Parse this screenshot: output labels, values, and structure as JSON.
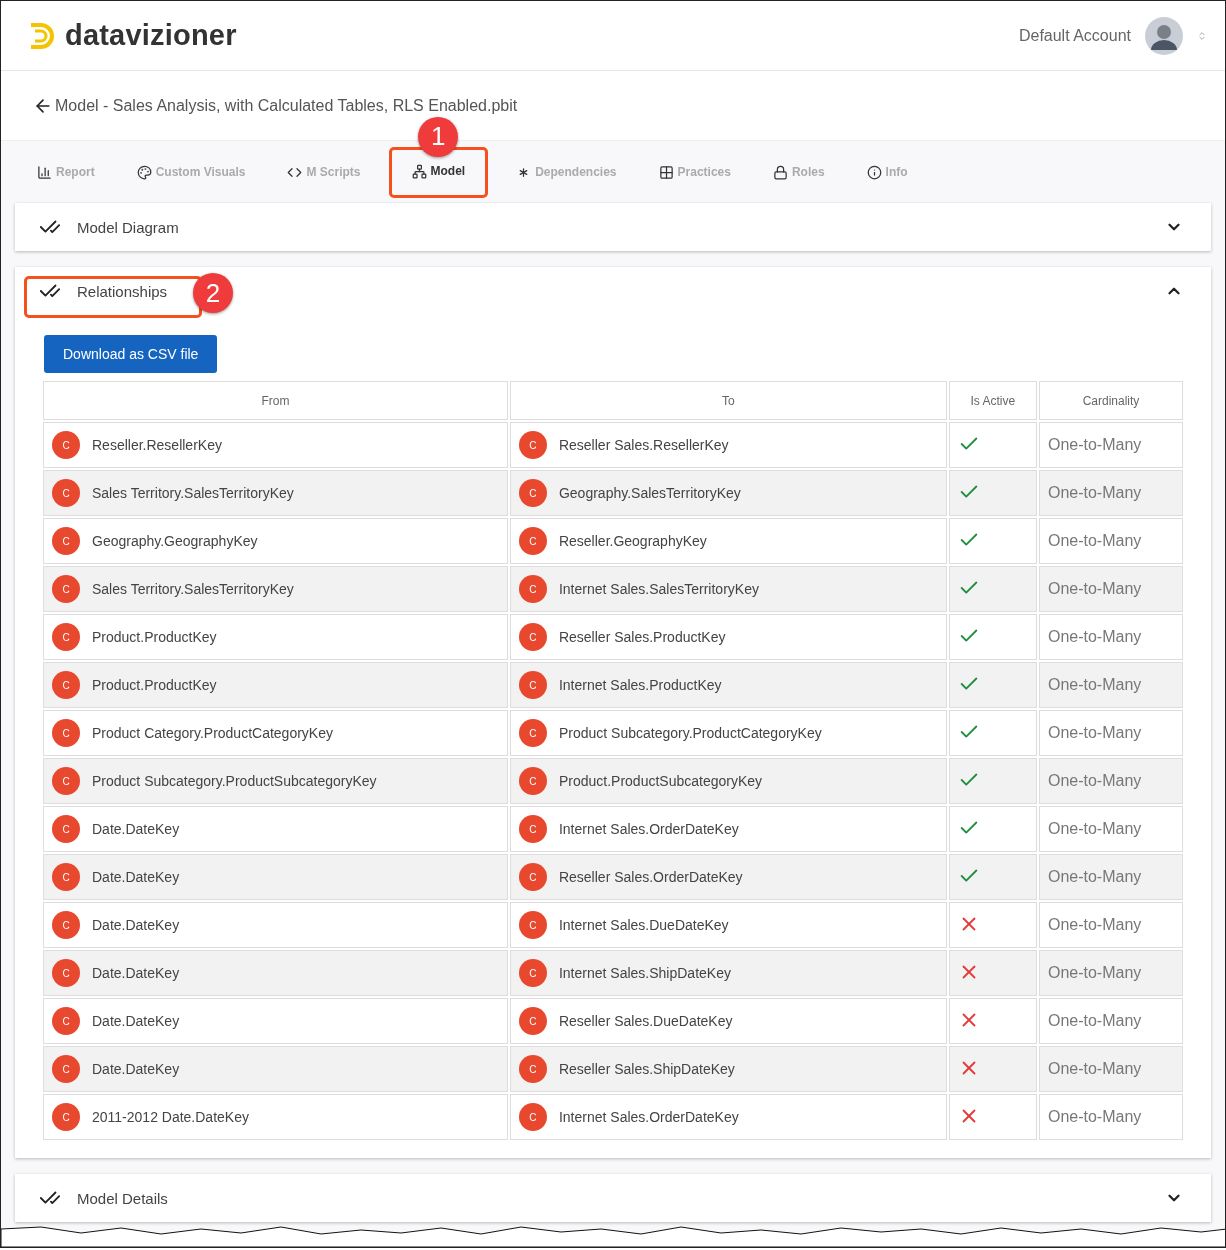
{
  "header": {
    "brand": "datavizioner",
    "account": "Default Account"
  },
  "breadcrumb": {
    "title": "Model - Sales Analysis, with Calculated Tables, RLS Enabled.pbit"
  },
  "tabs": [
    {
      "kind": "report",
      "label": "Report",
      "selected": false
    },
    {
      "kind": "visuals",
      "label": "Custom Visuals",
      "selected": false
    },
    {
      "kind": "scripts",
      "label": "M Scripts",
      "selected": false
    },
    {
      "kind": "model",
      "label": "Model",
      "selected": true,
      "callout": "1"
    },
    {
      "kind": "dependencies",
      "label": "Dependencies",
      "selected": false
    },
    {
      "kind": "practices",
      "label": "Practices",
      "selected": false
    },
    {
      "kind": "roles",
      "label": "Roles",
      "selected": false
    },
    {
      "kind": "info",
      "label": "Info",
      "selected": false
    }
  ],
  "panels": [
    {
      "title": "Model Diagram",
      "expanded": false
    },
    {
      "title": "Relationships",
      "expanded": true,
      "callout": "2",
      "download_button": "Download as CSV file",
      "table": {
        "columns": [
          "From",
          "To",
          "Is Active",
          "Cardinality"
        ],
        "rows": [
          {
            "from": {
              "badge": "C",
              "name": "Reseller.ResellerKey"
            },
            "to": {
              "badge": "C",
              "name": "Reseller Sales.ResellerKey"
            },
            "active": true,
            "cardinality": "One-to-Many"
          },
          {
            "from": {
              "badge": "C",
              "name": "Sales Territory.SalesTerritoryKey"
            },
            "to": {
              "badge": "C",
              "name": "Geography.SalesTerritoryKey"
            },
            "active": true,
            "cardinality": "One-to-Many"
          },
          {
            "from": {
              "badge": "C",
              "name": "Geography.GeographyKey"
            },
            "to": {
              "badge": "C",
              "name": "Reseller.GeographyKey"
            },
            "active": true,
            "cardinality": "One-to-Many"
          },
          {
            "from": {
              "badge": "C",
              "name": "Sales Territory.SalesTerritoryKey"
            },
            "to": {
              "badge": "C",
              "name": "Internet Sales.SalesTerritoryKey"
            },
            "active": true,
            "cardinality": "One-to-Many"
          },
          {
            "from": {
              "badge": "C",
              "name": "Product.ProductKey"
            },
            "to": {
              "badge": "C",
              "name": "Reseller Sales.ProductKey"
            },
            "active": true,
            "cardinality": "One-to-Many"
          },
          {
            "from": {
              "badge": "C",
              "name": "Product.ProductKey"
            },
            "to": {
              "badge": "C",
              "name": "Internet Sales.ProductKey"
            },
            "active": true,
            "cardinality": "One-to-Many"
          },
          {
            "from": {
              "badge": "C",
              "name": "Product Category.ProductCategoryKey"
            },
            "to": {
              "badge": "C",
              "name": "Product Subcategory.ProductCategoryKey"
            },
            "active": true,
            "cardinality": "One-to-Many"
          },
          {
            "from": {
              "badge": "C",
              "name": "Product Subcategory.ProductSubcategoryKey"
            },
            "to": {
              "badge": "C",
              "name": "Product.ProductSubcategoryKey"
            },
            "active": true,
            "cardinality": "One-to-Many"
          },
          {
            "from": {
              "badge": "C",
              "name": "Date.DateKey"
            },
            "to": {
              "badge": "C",
              "name": "Internet Sales.OrderDateKey"
            },
            "active": true,
            "cardinality": "One-to-Many"
          },
          {
            "from": {
              "badge": "C",
              "name": "Date.DateKey"
            },
            "to": {
              "badge": "C",
              "name": "Reseller Sales.OrderDateKey"
            },
            "active": true,
            "cardinality": "One-to-Many"
          },
          {
            "from": {
              "badge": "C",
              "name": "Date.DateKey"
            },
            "to": {
              "badge": "C",
              "name": "Internet Sales.DueDateKey"
            },
            "active": false,
            "cardinality": "One-to-Many"
          },
          {
            "from": {
              "badge": "C",
              "name": "Date.DateKey"
            },
            "to": {
              "badge": "C",
              "name": "Internet Sales.ShipDateKey"
            },
            "active": false,
            "cardinality": "One-to-Many"
          },
          {
            "from": {
              "badge": "C",
              "name": "Date.DateKey"
            },
            "to": {
              "badge": "C",
              "name": "Reseller Sales.DueDateKey"
            },
            "active": false,
            "cardinality": "One-to-Many"
          },
          {
            "from": {
              "badge": "C",
              "name": "Date.DateKey"
            },
            "to": {
              "badge": "C",
              "name": "Reseller Sales.ShipDateKey"
            },
            "active": false,
            "cardinality": "One-to-Many"
          },
          {
            "from": {
              "badge": "C",
              "name": "2011-2012 Date.DateKey"
            },
            "to": {
              "badge": "C",
              "name": "Internet Sales.OrderDateKey"
            },
            "active": false,
            "cardinality": "One-to-Many"
          }
        ]
      }
    },
    {
      "title": "Model Details",
      "expanded": false
    }
  ]
}
